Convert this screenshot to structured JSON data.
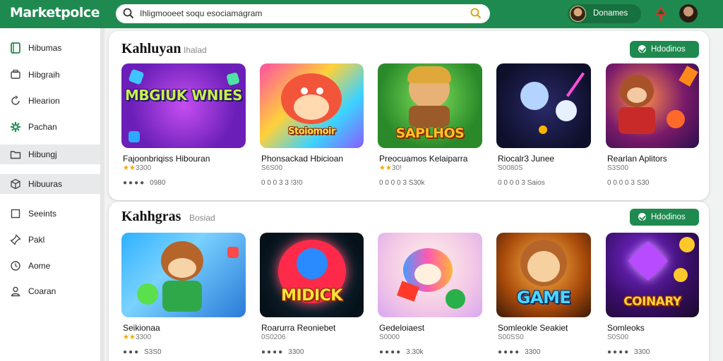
{
  "header": {
    "logo": "Marketpolce",
    "search_value": "Ihligmooeet soqu esociamagram",
    "user_name": "Donames"
  },
  "sidebar": {
    "items": [
      {
        "label": "Hibumas",
        "icon": "bookmark-icon",
        "active": false
      },
      {
        "label": "Hibgraih",
        "icon": "printer-icon",
        "active": false
      },
      {
        "label": "Hlearion",
        "icon": "refresh-icon",
        "active": false
      },
      {
        "label": "Pachan",
        "icon": "gear-icon",
        "active": false
      },
      {
        "label": "Hibungj",
        "icon": "folder-icon",
        "active": true
      },
      {
        "label": "Hibuuras",
        "icon": "cube-icon",
        "active": true
      },
      {
        "label": "Seeints",
        "icon": "square-icon",
        "active": false
      },
      {
        "label": "Pakl",
        "icon": "pin-icon",
        "active": false
      },
      {
        "label": "Aome",
        "icon": "clock-icon",
        "active": false
      },
      {
        "label": "Coaran",
        "icon": "user-icon",
        "active": false
      }
    ]
  },
  "sections": [
    {
      "title": "Kahluyan",
      "subtitle": "Ihalad",
      "button": "Hdodinos",
      "cards": [
        {
          "thumb_title": "MBGIUK WNIES",
          "name": "Fajoonbriqiss Hibouran",
          "rating": "★★",
          "rating_text": "3300",
          "footer": "0980"
        },
        {
          "thumb_title": "Stoiomoir",
          "name": "Phonsackad Hbicioan",
          "rating": "",
          "rating_text": "S6S00",
          "footer": "0 0 0 3 3 !3!0"
        },
        {
          "thumb_title": "SAPLHOS",
          "name": "Preocuamos Kelaiparra",
          "rating": "★★",
          "rating_text": "30!",
          "footer": "0 0 0 0 3 S30k"
        },
        {
          "thumb_title": "",
          "name": "Riocalr3 Junee",
          "rating": "",
          "rating_text": "S0080S",
          "footer": "0 0 0 0 3 Saios"
        },
        {
          "thumb_title": "",
          "name": "Rearlan Aplitors",
          "rating": "",
          "rating_text": "S3S00",
          "footer": "0 0 0 0 3 S30"
        }
      ]
    },
    {
      "title": "Kahhgras",
      "subtitle": "Bosiad",
      "button": "Hdodinos",
      "cards": [
        {
          "thumb_title": "",
          "name": "Seikionaa",
          "rating": "★★",
          "rating_text": "3300",
          "footer": "S3S0"
        },
        {
          "thumb_title": "MIDICK",
          "name": "Roarurra Reoniebet",
          "rating": "",
          "rating_text": "0S0206",
          "footer": "3300"
        },
        {
          "thumb_title": "",
          "name": "Gedeloiaest",
          "rating": "",
          "rating_text": "S0000",
          "footer": "3.30k"
        },
        {
          "thumb_title": "GAME",
          "name": "Somleokle Seakiet",
          "rating": "",
          "rating_text": "S00SS0",
          "footer": "3300"
        },
        {
          "thumb_title": "COINARY",
          "name": "Somleoks",
          "rating": "",
          "rating_text": "S0S00",
          "footer": "3300"
        }
      ]
    }
  ],
  "colors": {
    "brand": "#1f8a50",
    "brand_dark": "#17703f",
    "star": "#f0a800"
  }
}
